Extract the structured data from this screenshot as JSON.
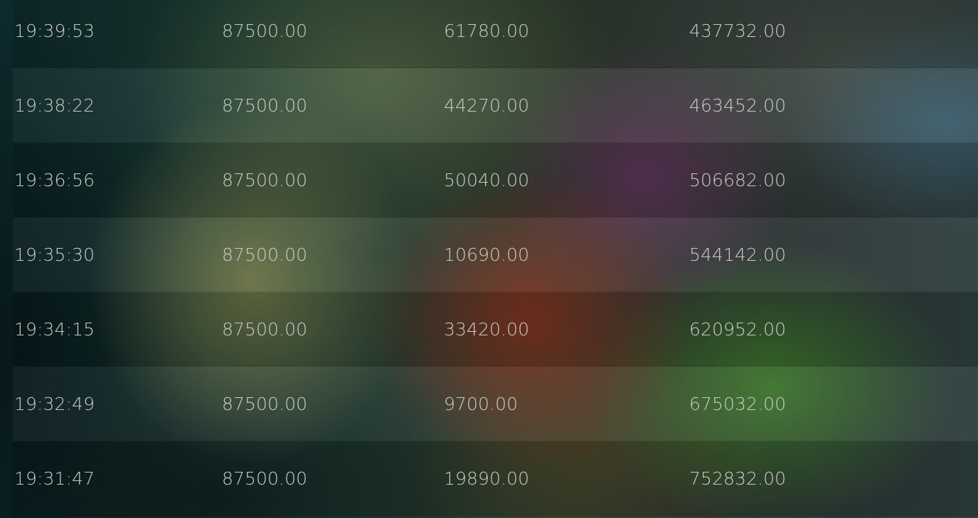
{
  "trades": {
    "rows": [
      {
        "time": "19:39:53",
        "price": "87500.00",
        "quantity": "61780.00",
        "total": "437732.00"
      },
      {
        "time": "19:38:22",
        "price": "87500.00",
        "quantity": "44270.00",
        "total": "463452.00"
      },
      {
        "time": "19:36:56",
        "price": "87500.00",
        "quantity": "50040.00",
        "total": "506682.00"
      },
      {
        "time": "19:35:30",
        "price": "87500.00",
        "quantity": "10690.00",
        "total": "544142.00"
      },
      {
        "time": "19:34:15",
        "price": "87500.00",
        "quantity": "33420.00",
        "total": "620952.00"
      },
      {
        "time": "19:32:49",
        "price": "87500.00",
        "quantity": "9700.00",
        "total": "675032.00"
      },
      {
        "time": "19:31:47",
        "price": "87500.00",
        "quantity": "19890.00",
        "total": "752832.00"
      }
    ]
  },
  "colors": {
    "text": "#c9ccc6",
    "background": "#14302f"
  }
}
